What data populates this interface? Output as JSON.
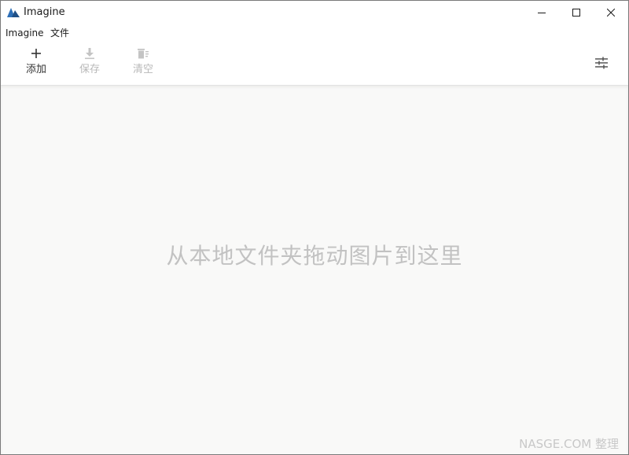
{
  "window": {
    "title": "Imagine",
    "accent_color": "#2d6fb7"
  },
  "menu": {
    "items": [
      {
        "label": "Imagine"
      },
      {
        "label": "文件"
      }
    ]
  },
  "toolbar": {
    "add_label": "添加",
    "save_label": "保存",
    "clear_label": "清空",
    "add_icon": "plus-icon",
    "save_icon": "download-icon",
    "clear_icon": "trash-icon",
    "settings_icon": "sliders-icon",
    "save_enabled": false,
    "clear_enabled": false
  },
  "content": {
    "drop_hint": "从本地文件夹拖动图片到这里"
  },
  "watermark": "NASGE.COM 整理"
}
